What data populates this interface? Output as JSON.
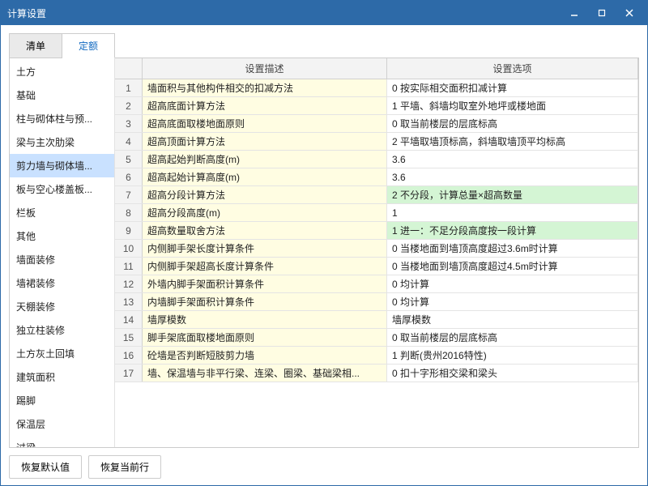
{
  "window": {
    "title": "计算设置"
  },
  "tabs": [
    "清单",
    "定额"
  ],
  "active_tab": 1,
  "sidebar": {
    "items": [
      "土方",
      "基础",
      "柱与砌体柱与预...",
      "梁与主次肋梁",
      "剪力墙与砌体墙...",
      "板与空心楼盖板...",
      "栏板",
      "其他",
      "墙面装修",
      "墙裙装修",
      "天棚装修",
      "独立柱装修",
      "土方灰土回填",
      "建筑面积",
      "踢脚",
      "保温层",
      "过梁"
    ],
    "selected_index": 4
  },
  "grid": {
    "columns": [
      "设置描述",
      "设置选项"
    ],
    "rows": [
      {
        "desc": "墙面积与其他构件相交的扣减方法",
        "opt": "0 按实际相交面积扣减计算",
        "hl": false
      },
      {
        "desc": "超高底面计算方法",
        "opt": "1 平墙、斜墙均取室外地坪或楼地面",
        "hl": false
      },
      {
        "desc": "超高底面取楼地面原则",
        "opt": "0 取当前楼层的层底标高",
        "hl": false
      },
      {
        "desc": "超高顶面计算方法",
        "opt": "2 平墙取墙顶标高，斜墙取墙顶平均标高",
        "hl": false
      },
      {
        "desc": "超高起始判断高度(m)",
        "opt": "3.6",
        "hl": false
      },
      {
        "desc": "超高起始计算高度(m)",
        "opt": "3.6",
        "hl": false
      },
      {
        "desc": "超高分段计算方法",
        "opt": "2 不分段，计算总量×超高数量",
        "hl": true
      },
      {
        "desc": "超高分段高度(m)",
        "opt": "1",
        "hl": false
      },
      {
        "desc": "超高数量取舍方法",
        "opt": "1 进一：不足分段高度按一段计算",
        "hl": true
      },
      {
        "desc": "内侧脚手架长度计算条件",
        "opt": "0 当楼地面到墙顶高度超过3.6m时计算",
        "hl": false
      },
      {
        "desc": "内侧脚手架超高长度计算条件",
        "opt": "0 当楼地面到墙顶高度超过4.5m时计算",
        "hl": false
      },
      {
        "desc": "外墙内脚手架面积计算条件",
        "opt": "0 均计算",
        "hl": false
      },
      {
        "desc": "内墙脚手架面积计算条件",
        "opt": "0 均计算",
        "hl": false
      },
      {
        "desc": "墙厚模数",
        "opt": "墙厚模数",
        "hl": false
      },
      {
        "desc": "脚手架底面取楼地面原则",
        "opt": "0 取当前楼层的层底标高",
        "hl": false
      },
      {
        "desc": "砼墙是否判断短肢剪力墙",
        "opt": "1 判断(贵州2016特性)",
        "hl": false
      },
      {
        "desc": "墙、保温墙与非平行梁、连梁、圈梁、基础梁相...",
        "opt": "0 扣十字形相交梁和梁头",
        "hl": false
      }
    ]
  },
  "footer": {
    "restore_defaults": "恢复默认值",
    "restore_row": "恢复当前行"
  }
}
